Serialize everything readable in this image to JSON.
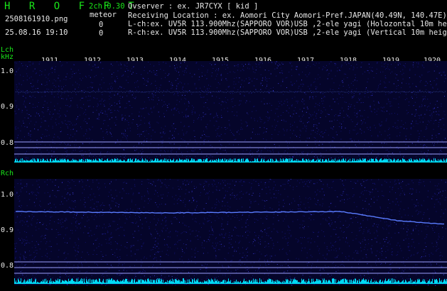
{
  "header": {
    "app_title": "H R O F F T",
    "mode": "2ch 0.30",
    "meteor_label": "meteor",
    "filename": "2508161910.png",
    "datetime": "25.08.16 19:10",
    "lch_count": "0",
    "rch_count": "0",
    "observer": "Ovserver           : ex. JR7CYX [ kid ]",
    "location": "Receiving Location : ex. Aomori City Aomori-Pref.JAPAN(40.49N, 140.47E)",
    "lch_info": "L-ch:ex. UV5R 113.900Mhz(SAPPORO VOR)USB ,2-ele yagi (Holozontal 10m height)",
    "rch_info": "R-ch:ex. UV5R 113.900Mhz(SAPPORO VOR)USB ,2-ele yagi (Vertical 10m height)"
  },
  "time_axis": {
    "ticks": [
      "1911",
      "1912",
      "1913",
      "1914",
      "1915",
      "1916",
      "1917",
      "1918",
      "1919",
      "1920"
    ]
  },
  "lch_panel": {
    "label": "Lch",
    "unit": "kHz",
    "yticks": [
      "1.0",
      "0.9",
      "0.8"
    ]
  },
  "rch_panel": {
    "label": "Rch",
    "yticks": [
      "1.0",
      "0.9",
      "0.8"
    ]
  },
  "colors": {
    "background": "#000000",
    "text_green": "#19e619",
    "text_white": "#e8e8e8",
    "noise": "#1a1a8c",
    "signal": "#5a7cff",
    "level": "#00e5ff",
    "ref_line": "#9aa0ff"
  }
}
